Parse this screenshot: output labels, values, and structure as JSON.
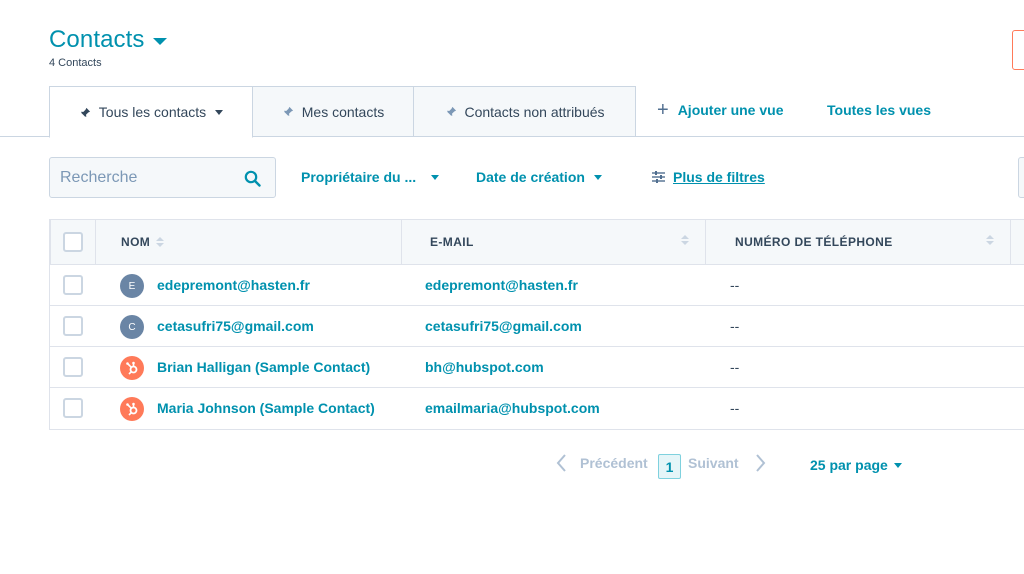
{
  "header": {
    "title": "Contacts",
    "count": "4 Contacts"
  },
  "tabs": [
    {
      "label": "Tous les contacts",
      "active": true
    },
    {
      "label": "Mes contacts",
      "active": false
    },
    {
      "label": "Contacts non attribués",
      "active": false
    }
  ],
  "tab_actions": {
    "add_view": "Ajouter une vue",
    "all_views": "Toutes les vues"
  },
  "filters": {
    "search_placeholder": "Recherche",
    "owner": "Propriétaire du ...",
    "created": "Date de création",
    "more": "Plus de filtres"
  },
  "table": {
    "columns": [
      "NOM",
      "E-MAIL",
      "NUMÉRO DE TÉLÉPHONE"
    ],
    "rows": [
      {
        "avatar": "E",
        "avatar_type": "letter",
        "name": "edepremont@hasten.fr",
        "email": "edepremont@hasten.fr",
        "phone": "--"
      },
      {
        "avatar": "C",
        "avatar_type": "letter",
        "name": "cetasufri75@gmail.com",
        "email": "cetasufri75@gmail.com",
        "phone": "--"
      },
      {
        "avatar": "hubspot-icon",
        "avatar_type": "hub",
        "name": "Brian Halligan (Sample Contact)",
        "email": "bh@hubspot.com",
        "phone": "--"
      },
      {
        "avatar": "hubspot-icon",
        "avatar_type": "hub",
        "name": "Maria Johnson (Sample Contact)",
        "email": "emailmaria@hubspot.com",
        "phone": "--"
      }
    ]
  },
  "pagination": {
    "prev": "Précédent",
    "page": "1",
    "next": "Suivant",
    "per_page": "25 par page"
  },
  "colors": {
    "accent": "#0091ae",
    "brand": "#ff7a59",
    "text": "#33475b",
    "border": "#cbd6e2"
  }
}
